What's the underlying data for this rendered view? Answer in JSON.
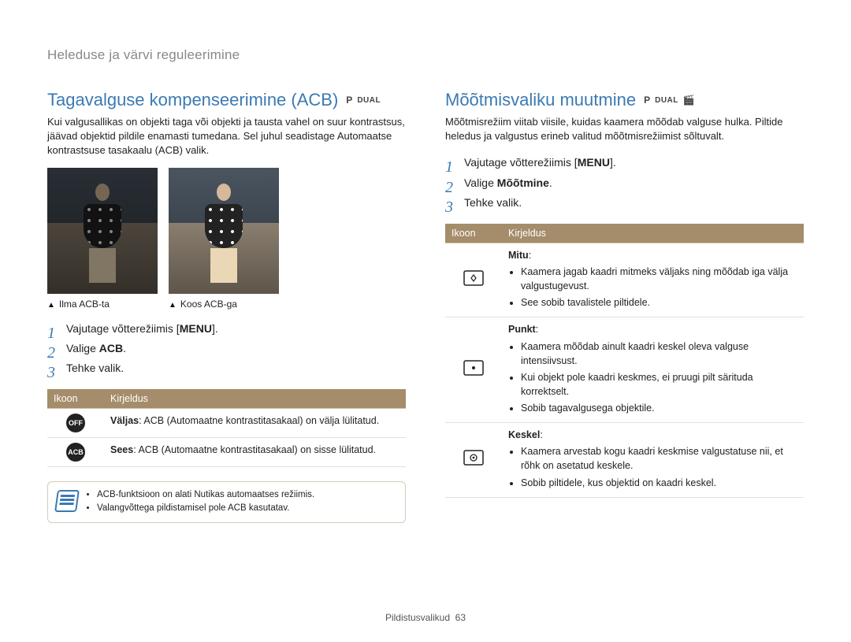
{
  "breadcrumb": "Heleduse ja värvi reguleerimine",
  "footer": {
    "label": "Pildistusvalikud",
    "page": "63"
  },
  "left": {
    "title": "Tagavalguse kompenseerimine (ACB)",
    "modes": [
      "P",
      "DUAL"
    ],
    "intro": "Kui valgusallikas on objekti taga või objekti ja tausta vahel on suur kontrastsus, jäävad objektid pildile enamasti tumedana. Sel juhul seadistage Automaatse kontrastsuse tasakaalu (ACB) valik.",
    "caption_a": "Ilma ACB-ta",
    "caption_b": "Koos ACB-ga",
    "step1_a": "Vajutage võtterežiimis [",
    "step1_menu": "MENU",
    "step1_b": "].",
    "step2_a": "Valige ",
    "step2_bold": "ACB",
    "step2_b": ".",
    "step3": "Tehke valik.",
    "table": {
      "h_icon": "Ikoon",
      "h_desc": "Kirjeldus",
      "r1_icon": "OFF",
      "r1_label": "Väljas",
      "r1_text": ": ACB (Automaatne kontrastitasakaal) on välja lülitatud.",
      "r2_icon": "ACB",
      "r2_label": "Sees",
      "r2_text": ": ACB (Automaatne kontrastitasakaal) on sisse lülitatud."
    },
    "note1": "ACB-funktsioon on alati Nutikas automaatses režiimis.",
    "note2": "Valangvõttega pildistamisel pole ACB kasutatav."
  },
  "right": {
    "title": "Mõõtmisvaliku muutmine",
    "modes": [
      "P",
      "DUAL",
      "🎬"
    ],
    "intro": "Mõõtmisrežiim viitab viisile, kuidas kaamera mõõdab valguse hulka. Piltide heledus ja valgustus erineb valitud mõõtmisrežiimist sõltuvalt.",
    "step1_a": "Vajutage võtterežiimis [",
    "step1_menu": "MENU",
    "step1_b": "].",
    "step2_a": "Valige ",
    "step2_bold": "Mõõtmine",
    "step2_b": ".",
    "step3": "Tehke valik.",
    "table": {
      "h_icon": "Ikoon",
      "h_desc": "Kirjeldus",
      "r1_label": "Mitu",
      "r1_b1": "Kaamera jagab kaadri mitmeks väljaks ning mõõdab iga välja valgustugevust.",
      "r1_b2": "See sobib tavalistele piltidele.",
      "r2_label": "Punkt",
      "r2_b1": "Kaamera mõõdab ainult kaadri keskel oleva valguse intensiivsust.",
      "r2_b2": "Kui objekt pole kaadri keskmes, ei pruugi pilt särituda korrektselt.",
      "r2_b3": "Sobib tagavalgusega objektile.",
      "r3_label": "Keskel",
      "r3_b1": "Kaamera arvestab kogu kaadri keskmise valgustatuse nii, et rõhk on asetatud keskele.",
      "r3_b2": "Sobib piltidele, kus objektid on kaadri keskel."
    }
  }
}
